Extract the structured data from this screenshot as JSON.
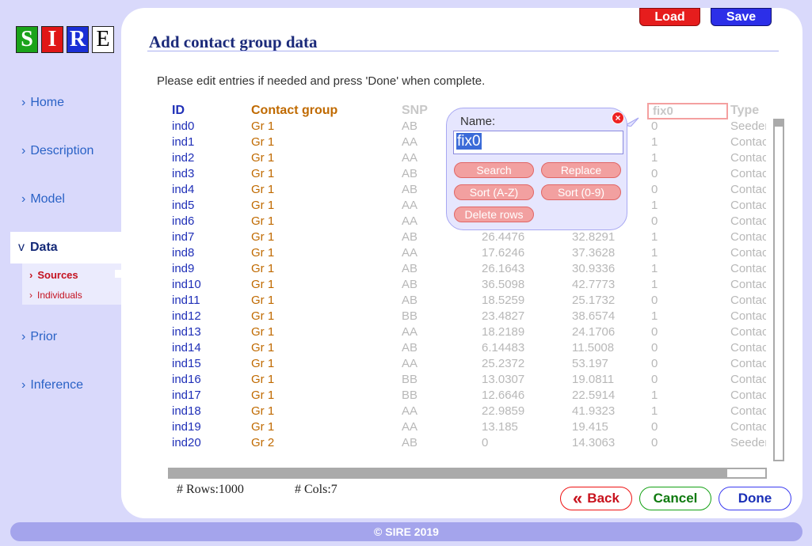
{
  "logo": {
    "letters": [
      "S",
      "I",
      "R",
      "E"
    ]
  },
  "nav": {
    "home": "Home",
    "description": "Description",
    "model": "Model",
    "data": "Data",
    "sources": "Sources",
    "individuals": "Individuals",
    "prior": "Prior",
    "inference": "Inference",
    "chev_right": "›",
    "chev_down": "v"
  },
  "header": {
    "load": "Load",
    "save": "Save"
  },
  "page": {
    "title": "Add contact group data",
    "instructions": "Please edit entries if needed and press 'Done' when complete."
  },
  "table": {
    "headers": {
      "id": "ID",
      "group": "Contact group",
      "snp": "SNP",
      "fix": "fix0",
      "type": "Type"
    },
    "rows": [
      {
        "id": "ind0",
        "group": "Gr 1",
        "snp": "AB",
        "v1": "",
        "v2": "",
        "fix": "0",
        "type": "Seeder"
      },
      {
        "id": "ind1",
        "group": "Gr 1",
        "snp": "AA",
        "v1": "",
        "v2": "",
        "fix": "1",
        "type": "Contact"
      },
      {
        "id": "ind2",
        "group": "Gr 1",
        "snp": "AA",
        "v1": "",
        "v2": "",
        "fix": "1",
        "type": "Contact"
      },
      {
        "id": "ind3",
        "group": "Gr 1",
        "snp": "AB",
        "v1": "",
        "v2": "",
        "fix": "0",
        "type": "Contact"
      },
      {
        "id": "ind4",
        "group": "Gr 1",
        "snp": "AB",
        "v1": "",
        "v2": "",
        "fix": "0",
        "type": "Contact"
      },
      {
        "id": "ind5",
        "group": "Gr 1",
        "snp": "AA",
        "v1": "",
        "v2": "",
        "fix": "1",
        "type": "Contact"
      },
      {
        "id": "ind6",
        "group": "Gr 1",
        "snp": "AA",
        "v1": "",
        "v2": "",
        "fix": "0",
        "type": "Contact"
      },
      {
        "id": "ind7",
        "group": "Gr 1",
        "snp": "AB",
        "v1": "26.4476",
        "v2": "32.8291",
        "fix": "1",
        "type": "Contact"
      },
      {
        "id": "ind8",
        "group": "Gr 1",
        "snp": "AA",
        "v1": "17.6246",
        "v2": "37.3628",
        "fix": "1",
        "type": "Contact"
      },
      {
        "id": "ind9",
        "group": "Gr 1",
        "snp": "AB",
        "v1": "26.1643",
        "v2": "30.9336",
        "fix": "1",
        "type": "Contact"
      },
      {
        "id": "ind10",
        "group": "Gr 1",
        "snp": "AB",
        "v1": "36.5098",
        "v2": "42.7773",
        "fix": "1",
        "type": "Contact"
      },
      {
        "id": "ind11",
        "group": "Gr 1",
        "snp": "AB",
        "v1": "18.5259",
        "v2": "25.1732",
        "fix": "0",
        "type": "Contact"
      },
      {
        "id": "ind12",
        "group": "Gr 1",
        "snp": "BB",
        "v1": "23.4827",
        "v2": "38.6574",
        "fix": "1",
        "type": "Contact"
      },
      {
        "id": "ind13",
        "group": "Gr 1",
        "snp": "AA",
        "v1": "18.2189",
        "v2": "24.1706",
        "fix": "0",
        "type": "Contact"
      },
      {
        "id": "ind14",
        "group": "Gr 1",
        "snp": "AB",
        "v1": "6.14483",
        "v2": "11.5008",
        "fix": "0",
        "type": "Contact"
      },
      {
        "id": "ind15",
        "group": "Gr 1",
        "snp": "AA",
        "v1": "25.2372",
        "v2": "53.197",
        "fix": "0",
        "type": "Contact"
      },
      {
        "id": "ind16",
        "group": "Gr 1",
        "snp": "BB",
        "v1": "13.0307",
        "v2": "19.0811",
        "fix": "0",
        "type": "Contact"
      },
      {
        "id": "ind17",
        "group": "Gr 1",
        "snp": "BB",
        "v1": "12.6646",
        "v2": "22.5914",
        "fix": "1",
        "type": "Contact"
      },
      {
        "id": "ind18",
        "group": "Gr 1",
        "snp": "AA",
        "v1": "22.9859",
        "v2": "41.9323",
        "fix": "1",
        "type": "Contact"
      },
      {
        "id": "ind19",
        "group": "Gr 1",
        "snp": "AA",
        "v1": "13.185",
        "v2": "19.415",
        "fix": "0",
        "type": "Contact"
      },
      {
        "id": "ind20",
        "group": "Gr 2",
        "snp": "AB",
        "v1": "0",
        "v2": "14.3063",
        "fix": "0",
        "type": "Seeder"
      }
    ]
  },
  "stats": {
    "rows": "# Rows:1000",
    "cols": "# Cols:7"
  },
  "buttons": {
    "back": "Back",
    "back_icon": "«",
    "cancel": "Cancel",
    "done": "Done"
  },
  "popup": {
    "name_label": "Name:",
    "name_value": "fix0",
    "close_glyph": "×",
    "search": "Search",
    "replace": "Replace",
    "sort_az": "Sort (A-Z)",
    "sort_09": "Sort (0-9)",
    "delete_rows": "Delete rows"
  },
  "footer": "© SIRE 2019"
}
